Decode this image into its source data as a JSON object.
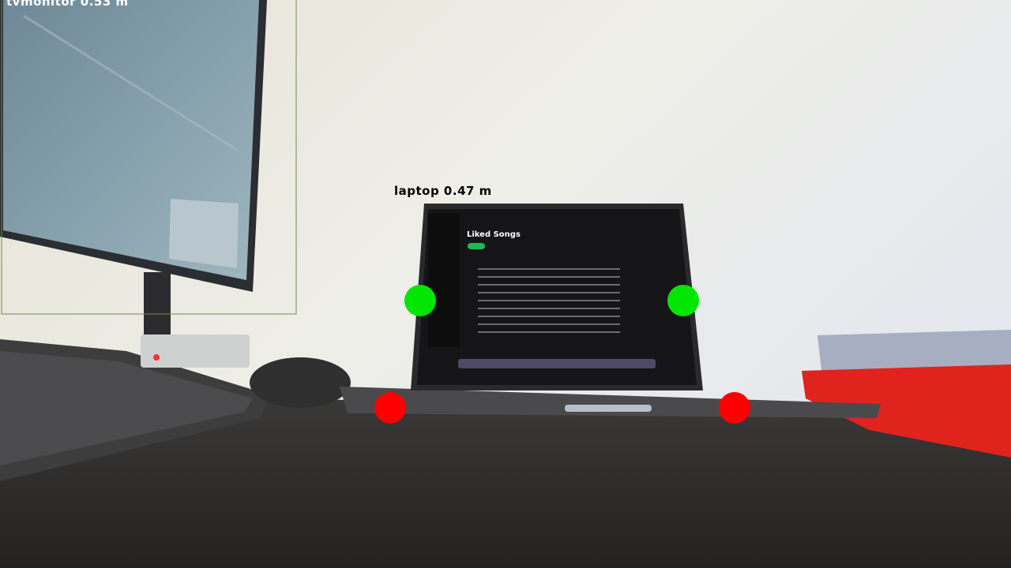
{
  "detections": [
    {
      "label": "tvmonitor 0.53 m",
      "text_color": "#ffffff",
      "box_color": "#6e8a4e"
    },
    {
      "label": "laptop 0.47 m",
      "text_color": "#000000"
    }
  ],
  "screen_heading": "Liked Songs",
  "markers": {
    "top_color": "#00e600",
    "bottom_color": "#ff0000"
  },
  "colors": {
    "wall": "#ece9e1",
    "desk": "#2d2c2b",
    "monitor_screen": "#7f9aa8",
    "laptop_screen": "#1a1a1c",
    "laptop_body": "#4a4a4d",
    "pillow": "#e0231c"
  }
}
